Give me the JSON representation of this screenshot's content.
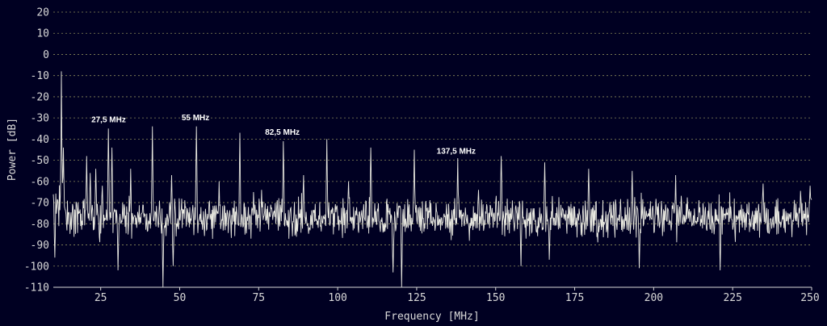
{
  "chart_data": {
    "type": "line",
    "title": "",
    "xlabel": "Frequency [MHz]",
    "ylabel": "Power [dB]",
    "xlim": [
      10,
      250
    ],
    "ylim": [
      -110,
      20
    ],
    "xticks": [
      25,
      50,
      75,
      100,
      125,
      150,
      175,
      200,
      225,
      250
    ],
    "yticks": [
      20,
      10,
      0,
      -10,
      -20,
      -30,
      -40,
      -50,
      -60,
      -70,
      -80,
      -90,
      -100,
      -110
    ],
    "grid": true,
    "noise_floor_db": -77,
    "peaks": [
      {
        "x": 12.5,
        "y": -8
      },
      {
        "x": 13.2,
        "y": -44
      },
      {
        "x": 20.5,
        "y": -48
      },
      {
        "x": 21.6,
        "y": -56
      },
      {
        "x": 23.5,
        "y": -54
      },
      {
        "x": 25.5,
        "y": -62
      },
      {
        "x": 27.5,
        "y": -35
      },
      {
        "x": 28.5,
        "y": -44
      },
      {
        "x": 34.5,
        "y": -54
      },
      {
        "x": 41.4,
        "y": -34
      },
      {
        "x": 47.5,
        "y": -57
      },
      {
        "x": 55.2,
        "y": -34
      },
      {
        "x": 62.5,
        "y": -60
      },
      {
        "x": 69.0,
        "y": -37
      },
      {
        "x": 76.0,
        "y": -64
      },
      {
        "x": 82.8,
        "y": -41
      },
      {
        "x": 89.2,
        "y": -57
      },
      {
        "x": 96.6,
        "y": -40
      },
      {
        "x": 103.5,
        "y": -60
      },
      {
        "x": 110.5,
        "y": -44
      },
      {
        "x": 124.2,
        "y": -45
      },
      {
        "x": 138.0,
        "y": -49
      },
      {
        "x": 144.5,
        "y": -64
      },
      {
        "x": 151.8,
        "y": -48
      },
      {
        "x": 165.6,
        "y": -51
      },
      {
        "x": 179.4,
        "y": -54
      },
      {
        "x": 193.2,
        "y": -55
      },
      {
        "x": 207.0,
        "y": -57
      },
      {
        "x": 220.8,
        "y": -58
      },
      {
        "x": 234.6,
        "y": -61
      },
      {
        "x": 249.6,
        "y": -62
      }
    ],
    "dips": [
      {
        "x": 10.5,
        "y": -96
      },
      {
        "x": 30.5,
        "y": -102
      },
      {
        "x": 44.8,
        "y": -110
      },
      {
        "x": 48.0,
        "y": -100
      },
      {
        "x": 117.5,
        "y": -103
      },
      {
        "x": 120.2,
        "y": -110
      },
      {
        "x": 158.0,
        "y": -100
      },
      {
        "x": 167.0,
        "y": -97
      },
      {
        "x": 195.5,
        "y": -101
      },
      {
        "x": 221.0,
        "y": -102
      }
    ],
    "annotations": [
      {
        "text": "27,5 MHz",
        "x": 27.5,
        "y": -32
      },
      {
        "text": "55 MHz",
        "x": 55.0,
        "y": -31
      },
      {
        "text": "82,5 MHz",
        "x": 82.5,
        "y": -38
      },
      {
        "text": "137,5 MHz",
        "x": 137.5,
        "y": -47
      }
    ]
  },
  "colors": {
    "background": "#000022",
    "trace": "#e8e8e0",
    "grid": "#8a8a5a",
    "text": "#d8d8d8"
  }
}
